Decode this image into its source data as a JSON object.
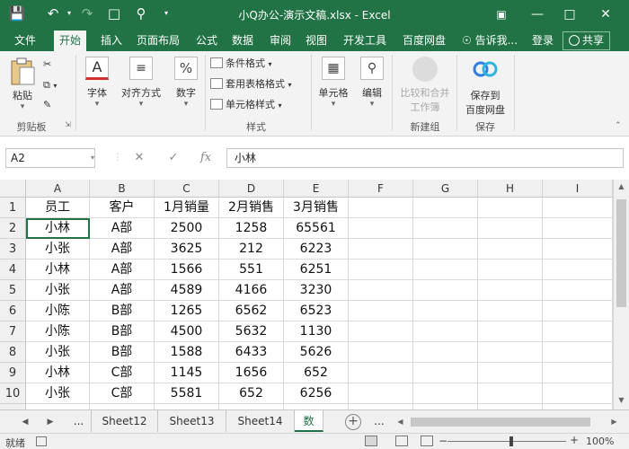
{
  "title": "小Q办公-演示文稿.xlsx - Excel",
  "tabs": [
    "文件",
    "开始",
    "插入",
    "页面布局",
    "公式",
    "数据",
    "审阅",
    "视图",
    "开发工具",
    "百度网盘"
  ],
  "tell_me": "告诉我...",
  "login": "登录",
  "share": "共享",
  "ribbon": {
    "paste": "粘贴",
    "clipboard_group": "剪贴板",
    "font": "字体",
    "align": "对齐方式",
    "number": "数字",
    "cond_format": "条件格式",
    "table_format": "套用表格格式",
    "cell_style": "单元格样式",
    "styles_group": "样式",
    "cells": "单元格",
    "edit": "编辑",
    "compare_merge_1": "比较和合并",
    "compare_merge_2": "工作簿",
    "new_group": "新建组",
    "save_baidu_1": "保存到",
    "save_baidu_2": "百度网盘",
    "save_group": "保存"
  },
  "formula_bar": {
    "name_box": "A2",
    "fx": "fx",
    "content": "小林"
  },
  "columns": [
    "A",
    "B",
    "C",
    "D",
    "E",
    "F",
    "G",
    "H",
    "I"
  ],
  "rows": [
    [
      "员工",
      "客户",
      "1月销量",
      "2月销售",
      "3月销售"
    ],
    [
      "小林",
      "A部",
      "2500",
      "1258",
      "65561"
    ],
    [
      "小张",
      "A部",
      "3625",
      "212",
      "6223"
    ],
    [
      "小林",
      "A部",
      "1566",
      "551",
      "6251"
    ],
    [
      "小张",
      "A部",
      "4589",
      "4166",
      "3230"
    ],
    [
      "小陈",
      "B部",
      "1265",
      "6562",
      "6523"
    ],
    [
      "小陈",
      "B部",
      "4500",
      "5632",
      "1130"
    ],
    [
      "小张",
      "B部",
      "1588",
      "6433",
      "5626"
    ],
    [
      "小林",
      "C部",
      "1145",
      "1656",
      "652"
    ],
    [
      "小张",
      "C部",
      "5581",
      "652",
      "6256"
    ]
  ],
  "row_numbers": [
    "1",
    "2",
    "3",
    "4",
    "5",
    "6",
    "7",
    "8",
    "9",
    "10"
  ],
  "sheets": {
    "ellipsis": "...",
    "tabs": [
      "Sheet12",
      "Sheet13",
      "Sheet14"
    ],
    "active": "数",
    "add": "+"
  },
  "status": {
    "ready": "就绪",
    "zoom": "100%"
  },
  "colors": {
    "accent": "#217346"
  }
}
